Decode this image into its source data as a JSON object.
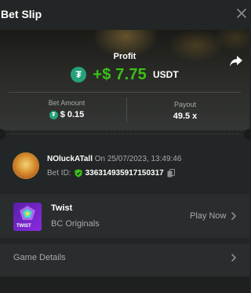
{
  "header": {
    "title": "Bet Slip"
  },
  "profit": {
    "label": "Profit",
    "amount": "+$ 7.75",
    "currency": "USDT"
  },
  "stats": {
    "bet_amount_label": "Bet Amount",
    "bet_amount_value": "$ 0.15",
    "payout_label": "Payout",
    "payout_value": "49.5 x"
  },
  "user": {
    "name": "NOluckATall",
    "on_text": "On 25/07/2023, 13:49:46",
    "bet_id_label": "Bet ID:",
    "bet_id": "336314935917150317"
  },
  "game": {
    "name": "Twist",
    "provider": "BC Originals",
    "thumb_label": "TWIST",
    "play_label": "Play Now"
  },
  "details": {
    "label": "Game Details"
  },
  "colors": {
    "profit_green": "#3bc117",
    "usdt_teal": "#26a17b",
    "background": "#232626",
    "muted_text": "#a6aaaa"
  },
  "icons": {
    "close": "close-icon",
    "share": "share-icon",
    "usdt": "usdt-coin-icon",
    "shield": "shield-check-icon",
    "copy": "copy-icon",
    "chevron": "chevron-right-icon"
  }
}
